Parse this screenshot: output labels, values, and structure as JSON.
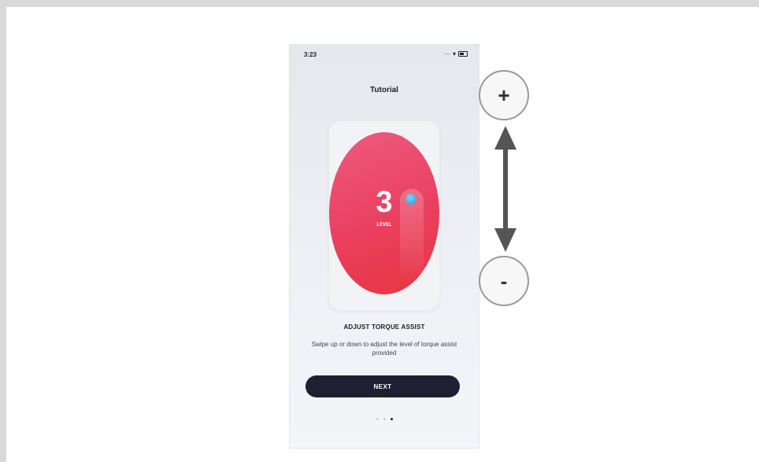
{
  "status_bar": {
    "time": "3:23",
    "icons": "... ▾"
  },
  "screen": {
    "title": "Tutorial",
    "level": {
      "value": "3",
      "label": "LEVEL"
    },
    "heading": "ADJUST TORQUE ASSIST",
    "description": "Swipe up or down to adjust the level of torque assist provided",
    "next_label": "NEXT",
    "pages": {
      "total": 3,
      "current": 3
    }
  },
  "controls": {
    "plus_label": "+",
    "minus_label": "-"
  },
  "colors": {
    "accent": "#ea3f5f",
    "button": "#1f1f33",
    "knob": "#2b93d8"
  }
}
